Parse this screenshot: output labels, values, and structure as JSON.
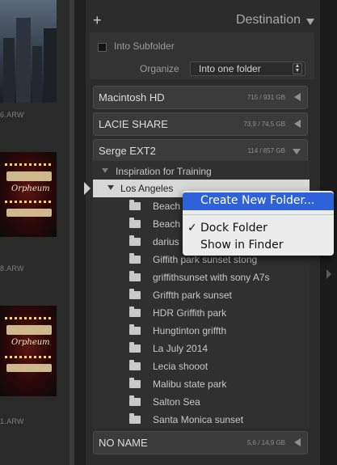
{
  "filmstrip": {
    "files": [
      "6.ARW",
      "8.ARW",
      "1.ARW"
    ]
  },
  "panel": {
    "add_icon": "+",
    "title": "Destination",
    "into_subfolder_label": "Into Subfolder",
    "organize_label": "Organize",
    "organize_value": "Into one folder",
    "select_arrows": "◆"
  },
  "volumes": [
    {
      "name": "Macintosh HD",
      "size": "715 / 931 GB",
      "state": "collapsed"
    },
    {
      "name": "LACIE SHARE",
      "size": "73,9 / 74,5 GB",
      "state": "collapsed"
    },
    {
      "name": "Serge EXT2",
      "size": "114 / 857 GB",
      "state": "expanded"
    },
    {
      "name": "NO NAME",
      "size": "5,6 / 14,9 GB",
      "state": "collapsed"
    }
  ],
  "tree": {
    "parent": "Inspiration for Training",
    "selected": "Los Angeles",
    "folders": [
      "Beach",
      "Beach",
      "darius",
      "Giffith park sunset stong",
      "griffithsunset with sony A7s",
      "Griffth park sunset",
      "HDR Griffith park",
      "Hungtinton griffth",
      "La July 2014",
      "Lecia shooot",
      "Malibu state park",
      "Salton Sea",
      "Santa Monica sunset"
    ]
  },
  "context_menu": {
    "items": [
      "Create New Folder...",
      "Dock Folder",
      "Show in Finder"
    ],
    "checkmark": "✓",
    "highlight_color": "#2f62d8"
  }
}
